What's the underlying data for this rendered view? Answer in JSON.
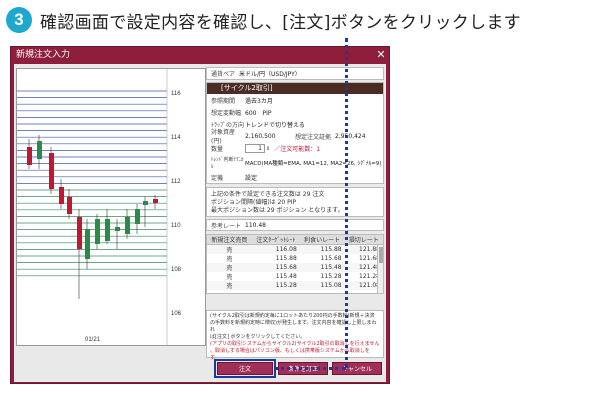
{
  "step": {
    "number": "3",
    "text": "確認画面で設定内容を確認し、[注文]ボタンをクリックします"
  },
  "window": {
    "title": "新規注文入力",
    "close": "✕"
  },
  "chart": {
    "y_ticks": [
      "116",
      "114",
      "112",
      "110",
      "108",
      "106"
    ],
    "x_label": "01/21"
  },
  "order": {
    "pair_label": "通貨ペア",
    "pair_value": "米ドル/円（USD/JPY）",
    "section_title": "[サイクル2取引]",
    "period_label": "参照期間",
    "period_value": "過去3カ月",
    "range_label": "想定変動幅",
    "range_value": "600　PIP",
    "direction_label": "ﾄﾗｯﾌﾟの方向",
    "direction_value": "トレンドで切り替える",
    "budget_label": "対象資産(円)",
    "budget_value": "2,160,500",
    "margin_label": "想定注文証拠",
    "margin_value": "2,950,424",
    "qty_label": "数量",
    "qty_value": "1",
    "qty_note": "／注文可能数：1",
    "tech_label": "ﾄﾚﾝﾄﾞ判断ﾃｸﾆｶﾙ",
    "tech_value": "MACD(MA種類=EMA, MA1=12, MA2=26, ｼｸﾞﾅﾙ=9)",
    "stop_label": "定機",
    "stop_value": "設定",
    "summary1": "上記の条件で設定できる注文数は 29 注文",
    "summary2": "ポジション間隔(値幅)は 20 PIP",
    "summary3": "最大ポジション数は 29 ポジション となります。",
    "ref_label": "参考レート",
    "ref_value": "110.48"
  },
  "table": {
    "headers": [
      "新規注文売買",
      "注文ﾀｰｹﾞｯﾄﾚｰﾄ",
      "利食いレート",
      "損切レート"
    ],
    "rows": [
      [
        "売",
        "116.08",
        "115.88",
        "121.88"
      ],
      [
        "売",
        "115.88",
        "115.68",
        "121.68"
      ],
      [
        "売",
        "115.68",
        "115.48",
        "121.48"
      ],
      [
        "売",
        "115.48",
        "115.28",
        "121.28"
      ],
      [
        "売",
        "115.28",
        "115.08",
        "121.08"
      ]
    ]
  },
  "notice": {
    "line1": "(サイクル2取引は新規約定毎に1ロットあたり200円の手数料(新規＋決済",
    "line2": "の手数料を新規約定時に徴収)が発生します。注文内容を確認し上限しまわれ",
    "line3": "ば[注文] ボタンをクリックしてください。",
    "line4": "(アプリの取引システムからサイクル2(サイクル2取引の取消しを行えません",
    "line5": "。取消しする場合はパソコン版、もしくは携帯版システムから取消しを",
    "line6": "す。"
  },
  "buttons": {
    "order": "注文",
    "correct": "条件を訂正",
    "cancel": "キャンセル"
  },
  "colors": {
    "accent": "#8d1e3c",
    "step_badge": "#1fa8cf",
    "dots": "#1a3a9c"
  }
}
